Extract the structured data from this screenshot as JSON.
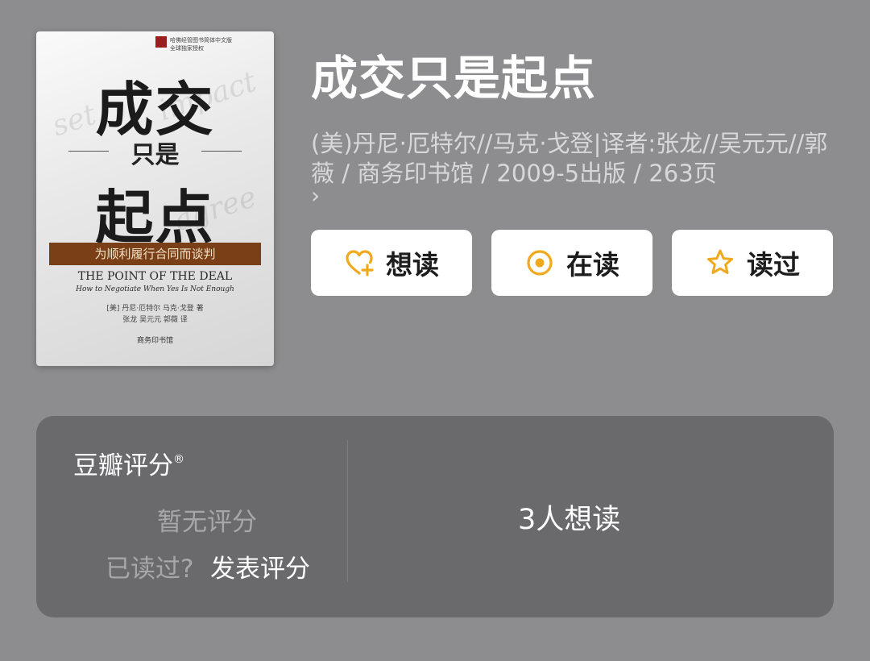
{
  "book": {
    "title": "成交只是起点",
    "meta_line": "(美)丹尼·厄特尔//马克·戈登|译者:张龙//吴元元//郭薇 / 商务印书馆 / 2009-5出版 / 263页",
    "more_arrow": "›",
    "cover": {
      "series_line": "哈佛经管图书简体中文版",
      "series_line2": "全球独家授权",
      "title_line1": "成交",
      "subtitle": "只是",
      "title_line2": "起点",
      "band_text": "为顺利履行合同而谈判",
      "en_title": "THE POINT OF THE DEAL",
      "en_subtitle": "How to Negotiate When Yes Is Not Enough",
      "authors": "[美] 丹尼·厄特尔   马克·戈登  著",
      "translators": "张龙   吴元元   郭薇   译",
      "publisher": "商务印书馆"
    }
  },
  "actions": {
    "want": {
      "label": "想读",
      "icon": "heart-plus-icon"
    },
    "reading": {
      "label": "在读",
      "icon": "radio-dot-icon"
    },
    "read": {
      "label": "读过",
      "icon": "star-icon"
    },
    "icon_color": "#f0a81c"
  },
  "rating": {
    "title": "豆瓣评分",
    "title_mark": "®",
    "no_rating": "暂无评分",
    "read_question": "已读过?",
    "post_rating": "发表评分",
    "want_count": "3人想读"
  }
}
